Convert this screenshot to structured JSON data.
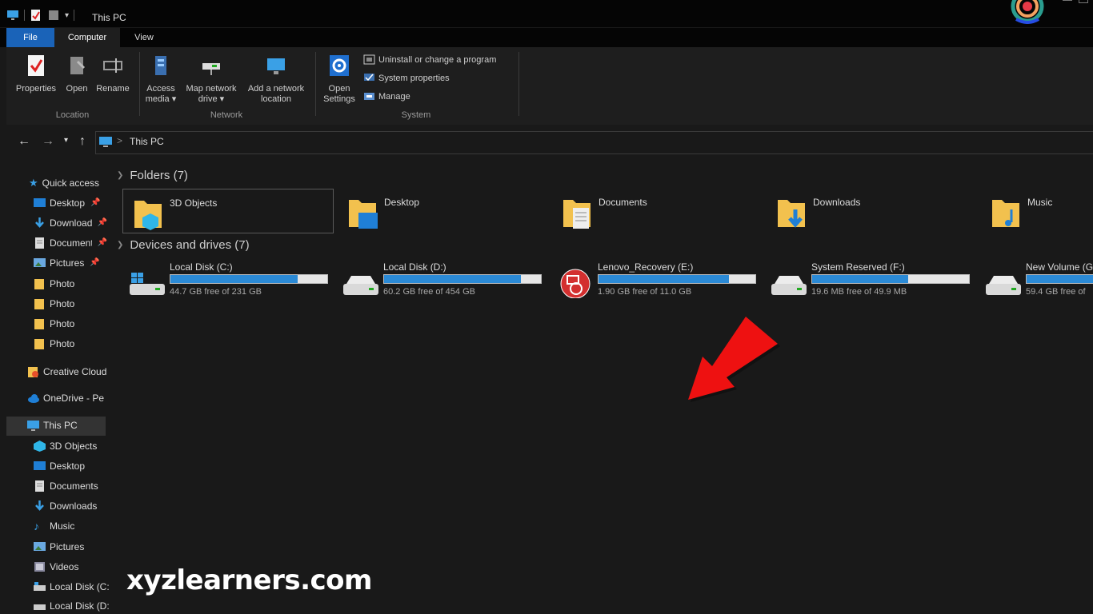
{
  "window": {
    "title": "This PC"
  },
  "ribbon_tabs": [
    {
      "label": "File"
    },
    {
      "label": "Computer"
    },
    {
      "label": "View"
    }
  ],
  "ribbon": {
    "location": {
      "label": "Location",
      "buttons": [
        {
          "label": "Properties"
        },
        {
          "label": "Open"
        },
        {
          "label": "Rename"
        }
      ]
    },
    "network": {
      "label": "Network",
      "buttons": [
        {
          "line1": "Access",
          "line2": "media ▾"
        },
        {
          "line1": "Map network",
          "line2": "drive ▾"
        },
        {
          "line1": "Add a network",
          "line2": "location"
        }
      ]
    },
    "system": {
      "label": "System",
      "open_settings": {
        "line1": "Open",
        "line2": "Settings"
      },
      "items": [
        {
          "label": "Uninstall or change a program"
        },
        {
          "label": "System properties"
        },
        {
          "label": "Manage"
        }
      ]
    }
  },
  "address": {
    "path": "This PC",
    "separator": ">"
  },
  "sidebar": {
    "quick_access": "Quick access",
    "pinned": [
      {
        "label": "Desktop",
        "icon": "desktop-icon"
      },
      {
        "label": "Downloads",
        "icon": "download-icon"
      },
      {
        "label": "Documents",
        "icon": "document-icon"
      },
      {
        "label": "Pictures",
        "icon": "pictures-icon"
      }
    ],
    "folders": [
      {
        "label": "Photo"
      },
      {
        "label": "Photo"
      },
      {
        "label": "Photo"
      },
      {
        "label": "Photo"
      }
    ],
    "creative_cloud": "Creative Cloud",
    "onedrive": "OneDrive - Pe",
    "this_pc": "This PC",
    "pc_items": [
      {
        "label": "3D Objects",
        "icon": "3d-objects-icon"
      },
      {
        "label": "Desktop",
        "icon": "desktop-icon"
      },
      {
        "label": "Documents",
        "icon": "document-icon"
      },
      {
        "label": "Downloads",
        "icon": "download-icon"
      },
      {
        "label": "Music",
        "icon": "music-icon"
      },
      {
        "label": "Pictures",
        "icon": "pictures-icon"
      },
      {
        "label": "Videos",
        "icon": "videos-icon"
      },
      {
        "label": "Local Disk (C:)",
        "icon": "drive-icon"
      },
      {
        "label": "Local Disk (D:)",
        "icon": "drive-icon"
      }
    ]
  },
  "folders_section": {
    "title": "Folders (7)",
    "items": [
      {
        "label": "3D Objects"
      },
      {
        "label": "Desktop"
      },
      {
        "label": "Documents"
      },
      {
        "label": "Downloads"
      },
      {
        "label": "Music"
      }
    ]
  },
  "drives_section": {
    "title": "Devices and drives (7)",
    "items": [
      {
        "label": "Local Disk (C:)",
        "free": "44.7 GB free of 231 GB",
        "used_fraction": 0.81
      },
      {
        "label": "Local Disk (D:)",
        "free": "60.2 GB free of 454 GB",
        "used_fraction": 0.87
      },
      {
        "label": "Lenovo_Recovery (E:)",
        "free": "1.90 GB free of 11.0 GB",
        "used_fraction": 0.83
      },
      {
        "label": "System Reserved (F:)",
        "free": "19.6 MB free of 49.9 MB",
        "used_fraction": 0.61
      },
      {
        "label": "New Volume (G:)",
        "free": "59.4 GB free of",
        "used_fraction": 0.85
      }
    ]
  },
  "watermark": "xyzlearners.com",
  "colors": {
    "accent": "#1a63b8",
    "bar_fill": "#2b8ad6",
    "arrow": "#ee1111"
  }
}
